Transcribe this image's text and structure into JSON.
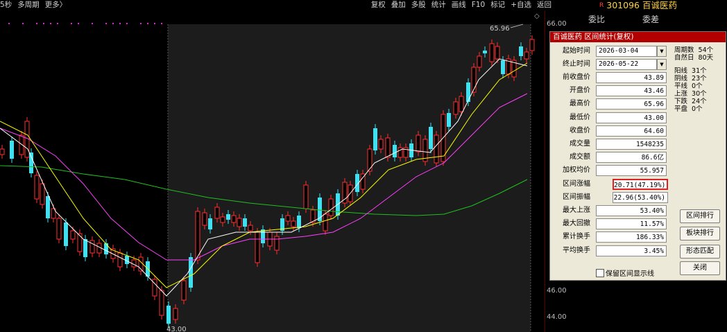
{
  "topbar": {
    "left_tabs": [
      "5秒",
      "多周期",
      "更多〉"
    ],
    "right_tabs": [
      "复权",
      "叠加",
      "多股",
      "统计",
      "画线",
      "F10",
      "标记",
      "+自选",
      "返回"
    ]
  },
  "stock": {
    "code": "301096",
    "name": "百诚医药",
    "mark": "R"
  },
  "right_panel": {
    "col1": "委比",
    "col2": "委差"
  },
  "price_axis": [
    "66.00",
    "46.00",
    "44.00"
  ],
  "chart_annotations": {
    "high": "65.96",
    "low": "43.00"
  },
  "dialog": {
    "title": "百诚医药 区间统计(复权)",
    "start_label": "起始时间",
    "start_value": "2026-03-04",
    "end_label": "终止时间",
    "end_value": "2026-05-22",
    "fields": [
      {
        "label": "前收盘价",
        "value": "43.89"
      },
      {
        "label": "开盘价",
        "value": "43.46"
      },
      {
        "label": "最高价",
        "value": "65.96"
      },
      {
        "label": "最低价",
        "value": "43.00"
      },
      {
        "label": "收盘价",
        "value": "64.60"
      },
      {
        "label": "成交量",
        "value": "1548235"
      },
      {
        "label": "成交额",
        "value": "86.6亿"
      },
      {
        "label": "加权均价",
        "value": "55.957"
      },
      {
        "label": "区间涨幅",
        "value": "20.71(47.19%)"
      },
      {
        "label": "区间振幅",
        "value": "22.96(53.40%)"
      },
      {
        "label": "最大上涨",
        "value": "53.40%"
      },
      {
        "label": "最大回撤",
        "value": "11.57%"
      },
      {
        "label": "累计换手",
        "value": "186.33%"
      },
      {
        "label": "平均换手",
        "value": "3.45%"
      }
    ],
    "stats_top": "周期数  54个\n自然日  80天",
    "stats_mid": "阳线  31个\n阴线  23个\n平线  0个\n上涨  30个\n下跌  24个\n平盘  0个",
    "buttons": [
      "区间排行",
      "板块排行",
      "形态匹配",
      "关闭"
    ],
    "checkbox_label": "保留区间显示线"
  },
  "colors": {
    "up": "#ff3030",
    "down": "#40e0f0",
    "ma5": "#ffffff",
    "ma10": "#ffff00",
    "ma20": "#ff40ff",
    "ma60": "#20c020"
  }
}
